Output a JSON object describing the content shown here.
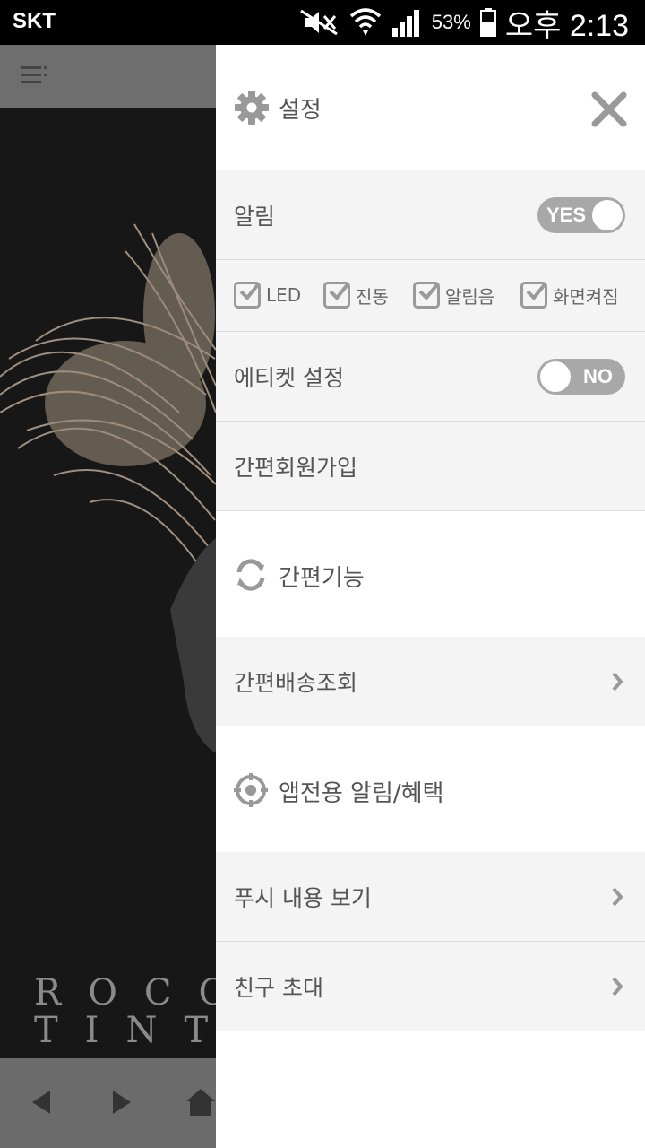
{
  "status_bar": {
    "carrier": "SKT",
    "battery_percent": "53%",
    "time": "오후 2:13"
  },
  "background": {
    "brand_line1": "ROCC",
    "brand_line2": "TINT"
  },
  "drawer": {
    "header_title": "설정",
    "settings": {
      "notification_label": "알림",
      "notification_toggle": "YES",
      "options": [
        "LED",
        "진동",
        "알림음",
        "화면켜짐"
      ],
      "etiquette_label": "에티켓 설정",
      "etiquette_toggle": "NO",
      "signup_label": "간편회원가입"
    },
    "quick_section": {
      "title": "간편기능",
      "delivery_label": "간편배송조회"
    },
    "benefit_section": {
      "title": "앱전용 알림/혜택",
      "push_label": "푸시 내용 보기",
      "invite_label": "친구 초대"
    }
  }
}
